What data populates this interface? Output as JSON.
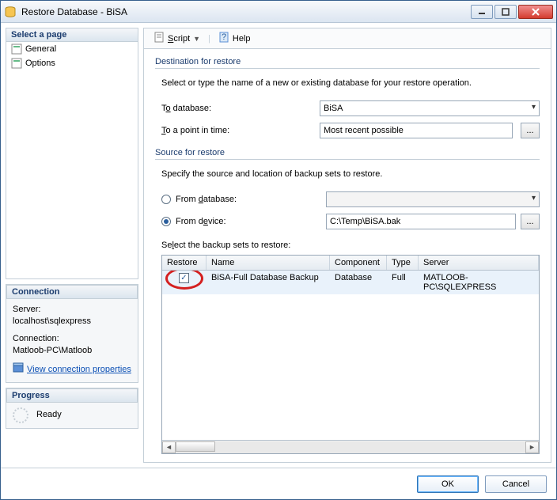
{
  "window": {
    "title": "Restore Database - BiSA"
  },
  "pages": {
    "header": "Select a page",
    "items": [
      {
        "label": "General"
      },
      {
        "label": "Options"
      }
    ]
  },
  "toolbar": {
    "script": "Script",
    "help": "Help"
  },
  "destination": {
    "group": "Destination for restore",
    "hint": "Select or type the name of a new or existing database for your restore operation.",
    "toDatabaseLabel": "To database:",
    "toDatabaseValue": "BiSA",
    "pointInTimeLabel": "To a point in time:",
    "pointInTimeValue": "Most recent possible"
  },
  "source": {
    "group": "Source for restore",
    "hint": "Specify the source and location of backup sets to restore.",
    "fromDatabaseLabel": "From database:",
    "fromDatabaseValue": "",
    "fromDeviceLabel": "From device:",
    "fromDeviceValue": "C:\\Temp\\BiSA.bak",
    "selectSetsLabel": "Select the backup sets to restore:"
  },
  "grid": {
    "columns": [
      "Restore",
      "Name",
      "Component",
      "Type",
      "Server"
    ],
    "rows": [
      {
        "restore": true,
        "name": "BiSA-Full Database Backup",
        "component": "Database",
        "type": "Full",
        "server": "MATLOOB-PC\\SQLEXPRESS"
      }
    ]
  },
  "connection": {
    "header": "Connection",
    "serverLabel": "Server:",
    "serverValue": "localhost\\sqlexpress",
    "connLabel": "Connection:",
    "connValue": "Matloob-PC\\Matloob",
    "viewProps": "View connection properties"
  },
  "progress": {
    "header": "Progress",
    "status": "Ready"
  },
  "footer": {
    "ok": "OK",
    "cancel": "Cancel"
  }
}
